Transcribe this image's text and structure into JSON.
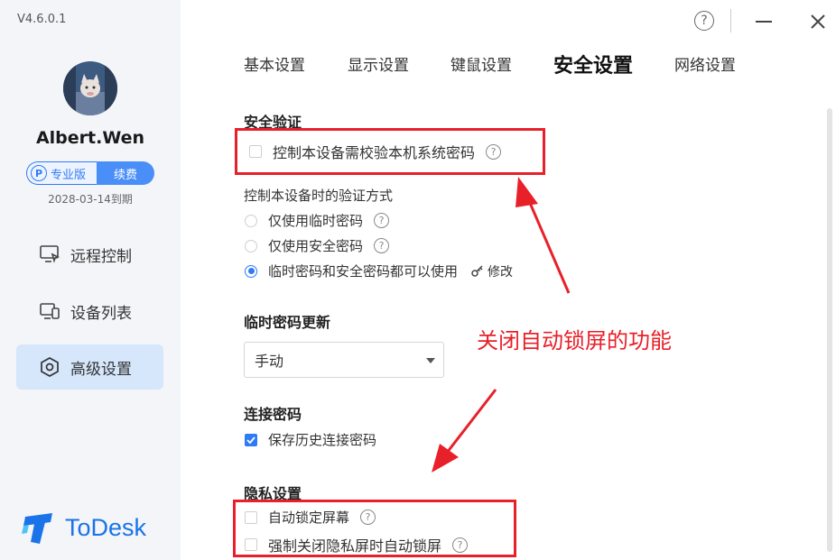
{
  "app": {
    "version": "V4.6.0.1",
    "logo_text": "ToDesk"
  },
  "user": {
    "name": "Albert.Wen",
    "edition": "专业版",
    "renew": "续费",
    "expiry": "2028-03-14到期"
  },
  "sidebar": {
    "items": [
      {
        "label": "远程控制",
        "icon": "monitor-cursor-icon"
      },
      {
        "label": "设备列表",
        "icon": "devices-icon"
      },
      {
        "label": "高级设置",
        "icon": "settings-hexagon-icon",
        "active": true
      }
    ]
  },
  "window": {
    "help": "?"
  },
  "tabs": [
    {
      "label": "基本设置"
    },
    {
      "label": "显示设置"
    },
    {
      "label": "键鼠设置"
    },
    {
      "label": "安全设置",
      "active": true
    },
    {
      "label": "网络设置"
    }
  ],
  "security": {
    "verify_title": "安全验证",
    "verify_checkbox": "控制本设备需校验本机系统密码",
    "method_label": "控制本设备时的验证方式",
    "methods": [
      {
        "label": "仅使用临时密码",
        "selected": false
      },
      {
        "label": "仅使用安全密码",
        "selected": false
      },
      {
        "label": "临时密码和安全密码都可以使用",
        "selected": true
      }
    ],
    "modify_label": "修改",
    "temp_title": "临时密码更新",
    "temp_value": "手动",
    "conn_title": "连接密码",
    "conn_checkbox": "保存历史连接密码",
    "privacy_title": "隐私设置",
    "privacy_items": [
      {
        "label": "自动锁定屏幕",
        "checked": false
      },
      {
        "label": "强制关闭隐私屏时自动锁屏",
        "checked": false
      }
    ]
  },
  "annotation": {
    "text": "关闭自动锁屏的功能",
    "color": "#e8202a"
  },
  "colors": {
    "accent": "#2f7bf5",
    "sidebar_bg": "#f3f5f8",
    "active_nav_bg": "#d6e6fb"
  }
}
